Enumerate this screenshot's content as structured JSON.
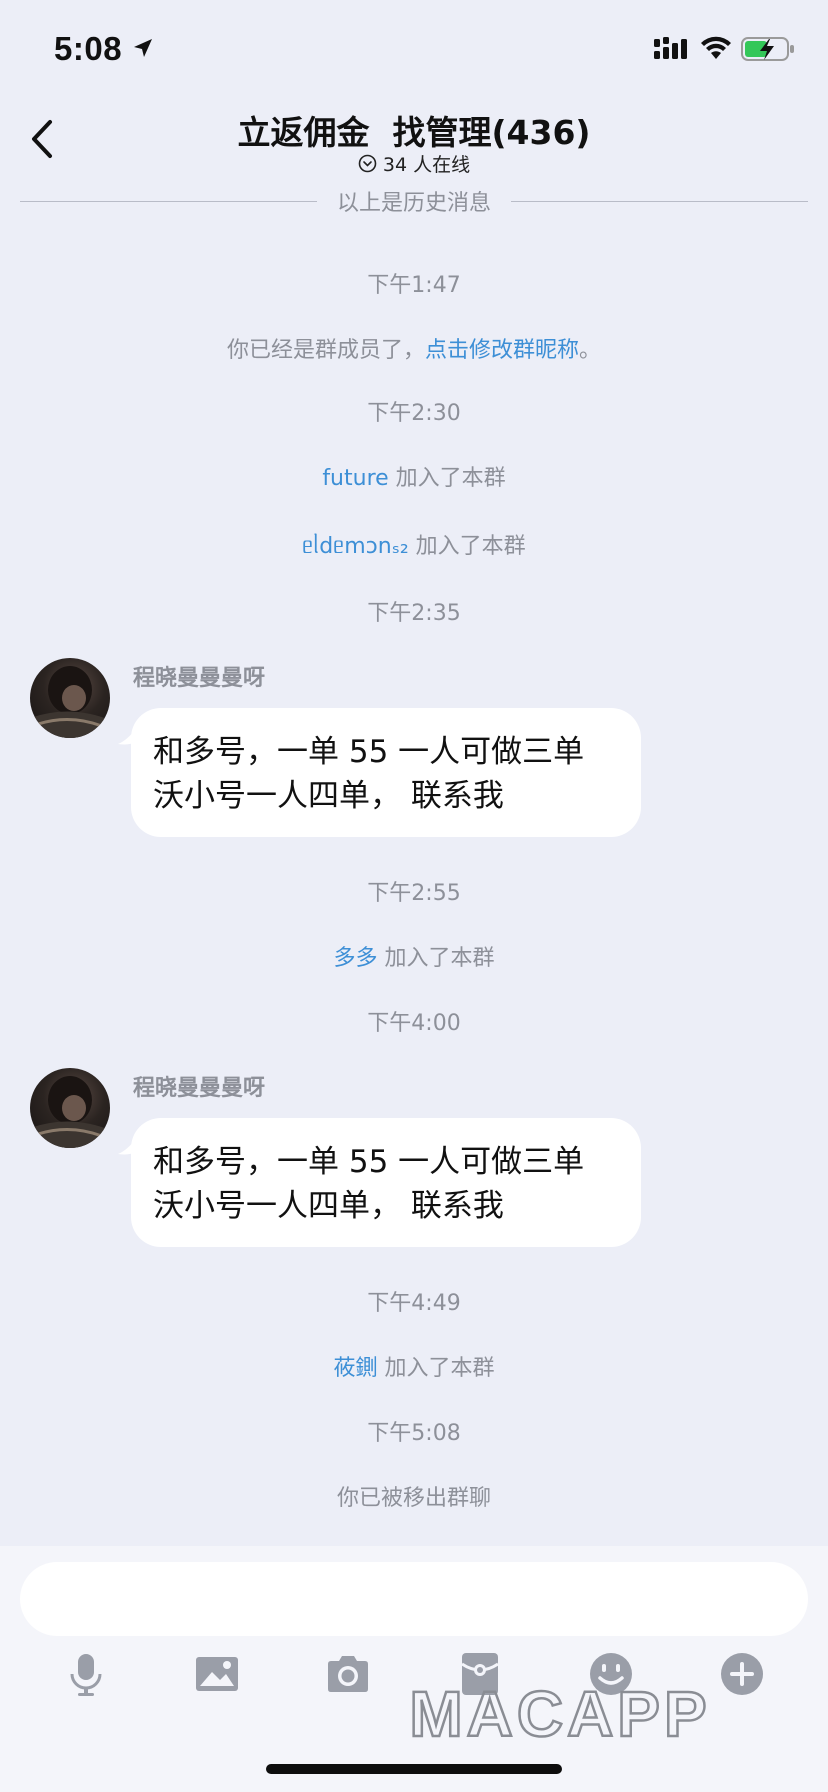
{
  "status_bar": {
    "time": "5:08"
  },
  "nav": {
    "title": "立返佣金  找管理(436)",
    "online": "34 人在线"
  },
  "chat": {
    "history_divider": "以上是历史消息",
    "t1": "下午1:47",
    "member_notice_prefix": "你已经是群成员了，",
    "member_notice_link": "点击修改群昵称",
    "member_notice_suffix": "。",
    "t2": "下午2:30",
    "join1_name": "future",
    "join_suffix": " 加入了本群",
    "join2_name": "ᥱᥣdᥱmɔnₛ₂",
    "t3": "下午2:35",
    "msg1_sender": "程晓曼曼曼呀",
    "msg1_line1": "和多号，一单 55 一人可做三单",
    "msg1_line2": "沃小号一人四单， 联系我",
    "t4": "下午2:55",
    "join3_name": "多多",
    "t5": "下午4:00",
    "msg2_sender": "程晓曼曼曼呀",
    "msg2_line1": "和多号，一单 55 一人可做三单",
    "msg2_line2": "沃小号一人四单， 联系我",
    "t6": "下午4:49",
    "join4_name": "莜鍘",
    "t7": "下午5:08",
    "removed_notice": "你已被移出群聊"
  },
  "toolbar": {
    "icons": [
      "microphone-icon",
      "image-icon",
      "camera-icon",
      "red-packet-icon",
      "emoji-icon",
      "plus-icon"
    ]
  },
  "watermark": "MACAPP",
  "colors": {
    "background": "#eceef7",
    "link": "#3d8fd6",
    "system_text": "#8d9099",
    "bubble": "#ffffff",
    "toolbar_icon": "#9a9ea8",
    "battery_green": "#34c759"
  }
}
